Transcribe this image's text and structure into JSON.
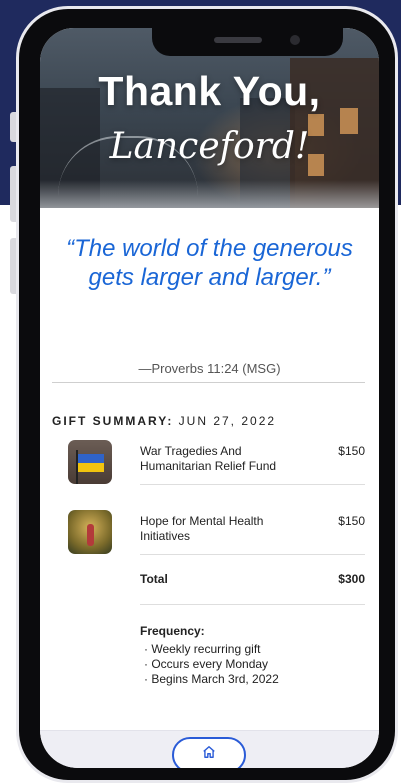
{
  "hero": {
    "title": "Thank You,",
    "name": "Lanceford!"
  },
  "quote": {
    "text": "“The world of the generous gets larger and larger.”",
    "source": "—Proverbs 11:24 (MSG)"
  },
  "gift_summary": {
    "label": "GIFT SUMMARY:",
    "date": "JUN 27, 2022",
    "items": [
      {
        "name": "War Tragedies And Humanitarian Relief Fund",
        "amount": "$150"
      },
      {
        "name": "Hope for Mental Health Initiatives",
        "amount": "$150"
      }
    ],
    "total_label": "Total",
    "total_amount": "$300"
  },
  "frequency": {
    "label": "Frequency:",
    "items": [
      "Weekly recurring gift",
      "Occurs every Monday",
      "Begins March 3rd, 2022"
    ]
  },
  "nav": {
    "home_icon": "home-icon"
  },
  "colors": {
    "accent": "#1a66d6",
    "bottom_button_border": "#2a5bd7"
  }
}
